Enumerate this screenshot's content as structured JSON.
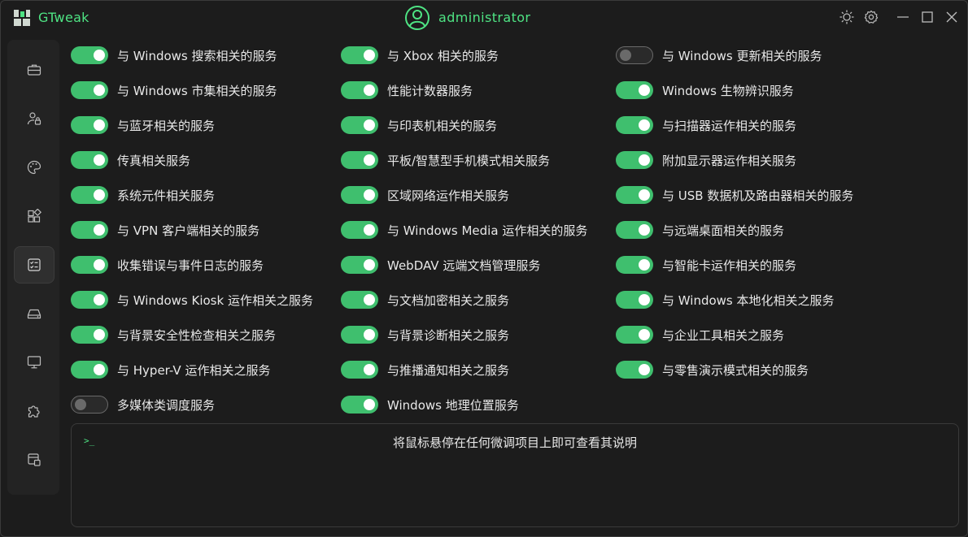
{
  "app": {
    "title": "GTweak",
    "user": "administrator"
  },
  "titlebar": {
    "icons": [
      "theme-sun-icon",
      "settings-gear-icon",
      "minimize-icon",
      "maximize-icon",
      "close-icon"
    ]
  },
  "sidebar": {
    "items": [
      {
        "icon": "briefcase-icon",
        "active": false
      },
      {
        "icon": "user-lock-icon",
        "active": false
      },
      {
        "icon": "palette-icon",
        "active": false
      },
      {
        "icon": "apps-icon",
        "active": false
      },
      {
        "icon": "services-checklist-icon",
        "active": true
      },
      {
        "icon": "drive-icon",
        "active": false
      },
      {
        "icon": "monitor-icon",
        "active": false
      },
      {
        "icon": "puzzle-icon",
        "active": false
      },
      {
        "icon": "system-info-icon",
        "active": false
      }
    ]
  },
  "colors": {
    "accent": "#4ee383",
    "toggle_on": "#3fbf6e",
    "background": "#1c1c1c"
  },
  "toggles": {
    "col1": [
      {
        "label": "与 Windows 搜索相关的服务",
        "on": true
      },
      {
        "label": "与 Windows 市集相关的服务",
        "on": true
      },
      {
        "label": "与蓝牙相关的服务",
        "on": true
      },
      {
        "label": "传真相关服务",
        "on": true
      },
      {
        "label": "系统元件相关服务",
        "on": true
      },
      {
        "label": "与 VPN 客户端相关的服务",
        "on": true
      },
      {
        "label": "收集错误与事件日志的服务",
        "on": true
      },
      {
        "label": "与 Windows Kiosk 运作相关之服务",
        "on": true
      },
      {
        "label": "与背景安全性检查相关之服务",
        "on": true
      },
      {
        "label": "与 Hyper-V 运作相关之服务",
        "on": true
      },
      {
        "label": "多媒体类调度服务",
        "on": false
      }
    ],
    "col2": [
      {
        "label": "与 Xbox 相关的服务",
        "on": true
      },
      {
        "label": "性能计数器服务",
        "on": true
      },
      {
        "label": "与印表机相关的服务",
        "on": true
      },
      {
        "label": "平板/智慧型手机模式相关服务",
        "on": true
      },
      {
        "label": "区域网络运作相关服务",
        "on": true
      },
      {
        "label": "与 Windows Media 运作相关的服务",
        "on": true
      },
      {
        "label": "WebDAV 远端文档管理服务",
        "on": true
      },
      {
        "label": "与文档加密相关之服务",
        "on": true
      },
      {
        "label": "与背景诊断相关之服务",
        "on": true
      },
      {
        "label": "与推播通知相关之服务",
        "on": true
      },
      {
        "label": "Windows 地理位置服务",
        "on": true
      }
    ],
    "col3": [
      {
        "label": "与 Windows 更新相关的服务",
        "on": false
      },
      {
        "label": "Windows 生物辨识服务",
        "on": true
      },
      {
        "label": "与扫描器运作相关的服务",
        "on": true
      },
      {
        "label": "附加显示器运作相关服务",
        "on": true
      },
      {
        "label": "与 USB 数据机及路由器相关的服务",
        "on": true
      },
      {
        "label": "与远端桌面相关的服务",
        "on": true
      },
      {
        "label": "与智能卡运作相关的服务",
        "on": true
      },
      {
        "label": "与 Windows 本地化相关之服务",
        "on": true
      },
      {
        "label": "与企业工具相关之服务",
        "on": true
      },
      {
        "label": "与零售演示模式相关的服务",
        "on": true
      }
    ]
  },
  "console": {
    "prompt": ">_",
    "message": "将鼠标悬停在任何微调项目上即可查看其说明"
  }
}
